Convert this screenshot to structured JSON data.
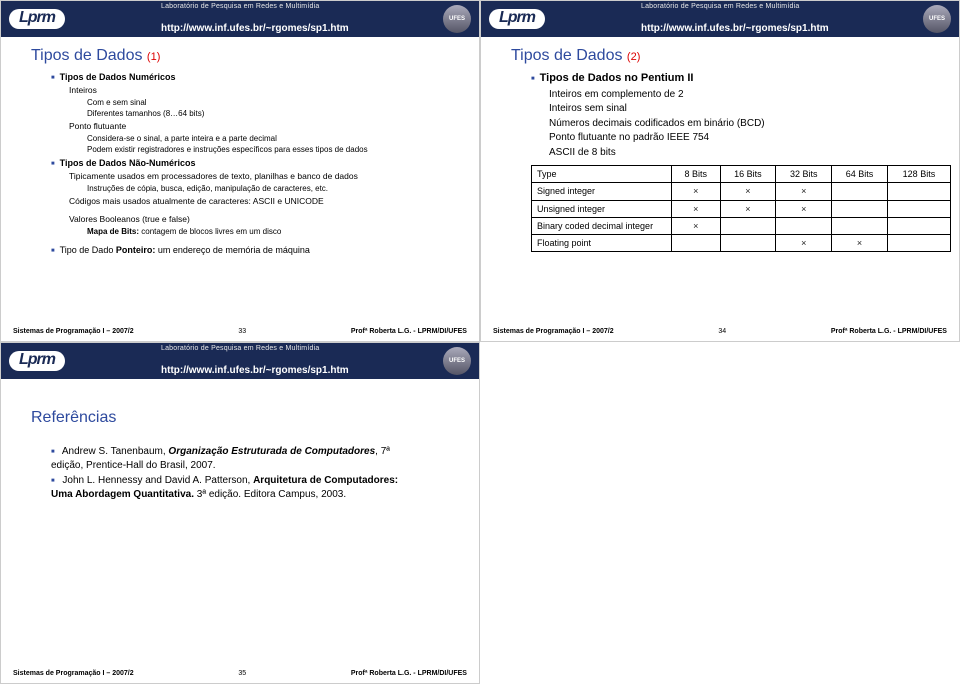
{
  "banner": {
    "lab": "Laboratório de Pesquisa em Redes e Multimídia",
    "url": "http://www.inf.ufes.br/~rgomes/sp1.htm",
    "logo": "Lprm",
    "ufes": "UFES"
  },
  "footer": {
    "left": "Sistemas de Programação I – 2007/2",
    "right": "Profª Roberta L.G. - LPRM/DI/UFES"
  },
  "slide33": {
    "title": "Tipos de Dados",
    "title_sub": "(1)",
    "h1": "Tipos de Dados Numéricos",
    "int": "Inteiros",
    "int_a": "Com e sem sinal",
    "int_b": "Diferentes tamanhos (8…64 bits)",
    "pf": "Ponto flutuante",
    "pf_a": "Considera-se o sinal, a parte inteira e a parte decimal",
    "pf_b": "Podem existir registradores e instruções específicos para esses tipos de dados",
    "h2": "Tipos de Dados Não-Numéricos",
    "nn_a": "Tipicamente usados em processadores de texto, planilhas e banco de dados",
    "nn_a1": "Instruções de cópia, busca, edição, manipulação de caracteres, etc.",
    "nn_b": "Códigos mais usados atualmente de caracteres: ASCII e UNICODE",
    "bool": "Valores Booleanos (true e false)",
    "bool_a_pre": "Mapa de Bits:",
    "bool_a_rest": " contagem de blocos livres em um disco",
    "ptr_pre": "Tipo de Dado ",
    "ptr_mid": "Ponteiro:",
    "ptr_rest": " um endereço de memória de máquina",
    "page": "33"
  },
  "slide34": {
    "title": "Tipos de Dados",
    "title_sub": "(2)",
    "h1": "Tipos de Dados no Pentium II",
    "i1": "Inteiros em complemento de 2",
    "i2": "Inteiros sem sinal",
    "i3": "Números decimais codificados em binário (BCD)",
    "i4": "Ponto flutuante no padrão IEEE 754",
    "i5": "ASCII de 8 bits",
    "table": {
      "headers": [
        "Type",
        "8 Bits",
        "16 Bits",
        "32 Bits",
        "64 Bits",
        "128 Bits"
      ],
      "rows": [
        {
          "label": "Signed integer",
          "cells": [
            "×",
            "×",
            "×",
            "",
            ""
          ]
        },
        {
          "label": "Unsigned integer",
          "cells": [
            "×",
            "×",
            "×",
            "",
            ""
          ]
        },
        {
          "label": "Binary coded decimal integer",
          "cells": [
            "×",
            "",
            "",
            "",
            ""
          ]
        },
        {
          "label": "Floating point",
          "cells": [
            "",
            "",
            "×",
            "×",
            ""
          ]
        }
      ]
    },
    "page": "34"
  },
  "slide35": {
    "title": "Referências",
    "r1_a": "Andrew S. Tanenbaum, ",
    "r1_b": "Organização Estruturada de Computadores",
    "r1_c": ", 7ª edição, Prentice-Hall do Brasil, 2007.",
    "r2_a": "John L. Hennessy and David A. Patterson, ",
    "r2_b": "Arquitetura de Computadores: Uma Abordagem Quantitativa.",
    "r2_c": " 3ª edição. Editora Campus, 2003.",
    "page": "35"
  }
}
